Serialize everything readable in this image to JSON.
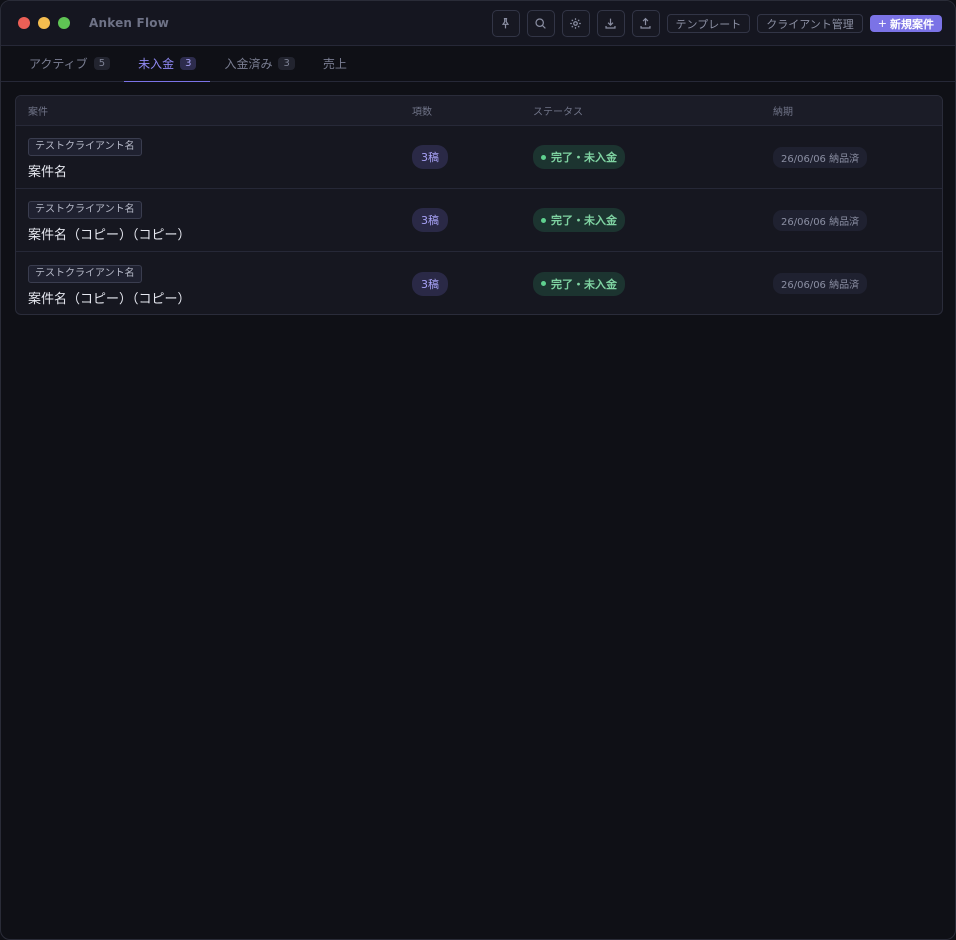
{
  "app": {
    "title": "Anken Flow"
  },
  "toolbar": {
    "icons": [
      "pin-icon",
      "search-icon",
      "gear-icon",
      "download-icon",
      "upload-icon"
    ],
    "template_label": "テンプレート",
    "client_mgmt_label": "クライアント管理",
    "new_case_label": "新規案件",
    "new_case_plus": "+"
  },
  "tabs": [
    {
      "label": "アクティブ",
      "count": "5",
      "active": false
    },
    {
      "label": "未入金",
      "count": "3",
      "active": true
    },
    {
      "label": "入金済み",
      "count": "3",
      "active": false
    },
    {
      "label": "売上",
      "count": "",
      "active": false
    }
  ],
  "table": {
    "headers": {
      "case": "案件",
      "qty": "項数",
      "status": "ステータス",
      "due": "納期"
    },
    "rows": [
      {
        "client": "テストクライアント名",
        "name": "案件名",
        "qty": "3稿",
        "status": "完了・未入金",
        "due": "26/06/06 納品済"
      },
      {
        "client": "テストクライアント名",
        "name": "案件名（コピー）（コピー）",
        "qty": "3稿",
        "status": "完了・未入金",
        "due": "26/06/06 納品済"
      },
      {
        "client": "テストクライアント名",
        "name": "案件名（コピー）（コピー）",
        "qty": "3稿",
        "status": "完了・未入金",
        "due": "26/06/06 納品済"
      }
    ]
  },
  "colors": {
    "accent": "#7b73e6",
    "status_green": "#5fd08f",
    "background": "#0f1016"
  }
}
